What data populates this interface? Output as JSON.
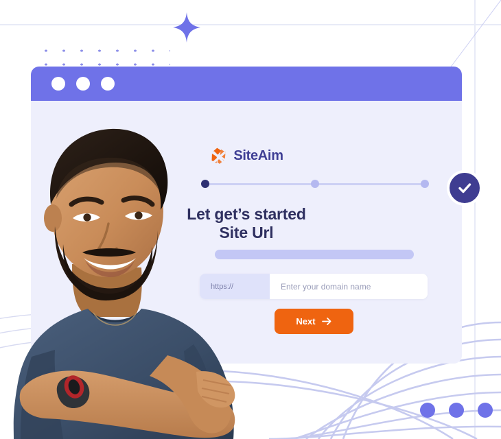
{
  "window": {
    "titlebar_buttons": [
      "close",
      "minimize",
      "maximize"
    ]
  },
  "brand": {
    "logo_icon": "siteaim-hex-x-logo",
    "name": "SiteAim",
    "logo_color": "#ef6410",
    "text_color": "#3f3f95"
  },
  "stepper": {
    "total_steps": 3,
    "current_step": 1,
    "steps": [
      {
        "index": 1,
        "state": "active",
        "color": "#2e3072"
      },
      {
        "index": 2,
        "state": "upcoming",
        "color": "#b4b8f0"
      },
      {
        "index": 3,
        "state": "upcoming",
        "color": "#b4b8f0"
      }
    ],
    "track_color": "#ccd0f4"
  },
  "headline": {
    "line1": "Let get’s started",
    "line2": "Site Url",
    "color": "#2f3060"
  },
  "subtitle_placeholder": {
    "label": "subtitle-placeholder-bar",
    "color": "#c3c7f5"
  },
  "form": {
    "url": {
      "prefix_label": "https://",
      "prefix_bg": "#dfe2fa",
      "placeholder": "Enter your domain name",
      "value": ""
    },
    "submit": {
      "label": "Next",
      "icon": "arrow-right-icon",
      "bg": "#ef6410",
      "text_color": "#ffffff"
    }
  },
  "status_badge": {
    "icon": "check-icon",
    "bg": "#3f3d91",
    "ring": "#ffffff"
  },
  "decorations": {
    "sparkle_icon": "four-point-star-icon",
    "sparkle_color": "#6f72e8",
    "dot_grid_top_color": "#8b8ee8",
    "dot_matrix_dark_color": "#3d3f92",
    "dot_matrix_light_color": "#a9acef",
    "bottom_right_dots_count": 3,
    "bottom_right_dot_color": "#6f72e8",
    "swirl_line_color": "#c6caef",
    "grid_line_color": "#e8ebf7",
    "titlebar_color": "#6f72e8",
    "card_bg": "#eeeffc",
    "page_bg": "#ffffff"
  },
  "photo": {
    "subject": "smiling-man-with-beard-arms-crossed",
    "shirt_color": "#3c4f69",
    "skin_color": "#c78b5e",
    "hair_color": "#241a14",
    "wristband_color": "#b2252a"
  }
}
